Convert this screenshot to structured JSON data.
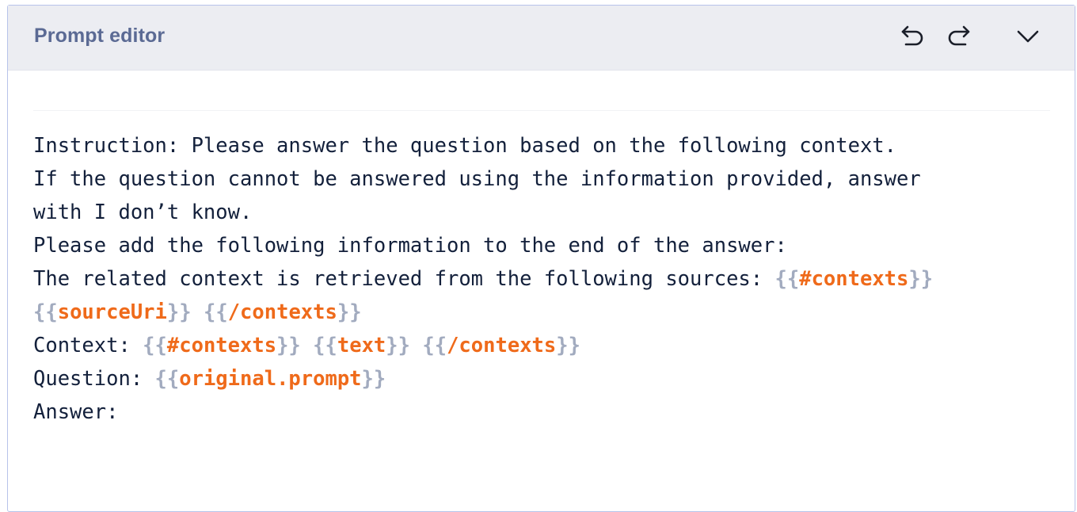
{
  "header": {
    "title": "Prompt editor",
    "icons": {
      "undo": "undo-icon",
      "redo": "redo-icon",
      "collapse": "chevron-down-icon"
    }
  },
  "editor": {
    "lines": [
      {
        "t0": "Instruction: Please answer the question based on the following context."
      },
      {
        "t0": "If the question cannot be answered using the information provided, answer"
      },
      {
        "t0": "with I don’t know."
      },
      {
        "t0": "Please add the following information to the end of the answer:"
      },
      {
        "t0": "The related context is retrieved from the following sources: ",
        "o1": "{{",
        "v1": "#contexts",
        "c1": "}}"
      },
      {
        "o1": "{{",
        "v1": "sourceUri",
        "c1": "}}",
        "s1": " ",
        "o2": "{{",
        "v2": "/contexts",
        "c2": "}}"
      },
      {
        "t0": "Context: ",
        "o1": "{{",
        "v1": "#contexts",
        "c1": "}}",
        "s1": " ",
        "o2": "{{",
        "v2": "text",
        "c2": "}}",
        "s2": " ",
        "o3": "{{",
        "v3": "/contexts",
        "c3": "}}"
      },
      {
        "t0": "Question: ",
        "o1": "{{",
        "v1": "original.prompt",
        "c1": "}}"
      },
      {
        "t0": "Answer:"
      }
    ]
  },
  "colors": {
    "title": "#5b6a94",
    "header_bg": "#ecedf2",
    "border": "#b7c3ea",
    "text": "#13203b",
    "brace": "#a2abbf",
    "variable": "#ef6a1a"
  }
}
